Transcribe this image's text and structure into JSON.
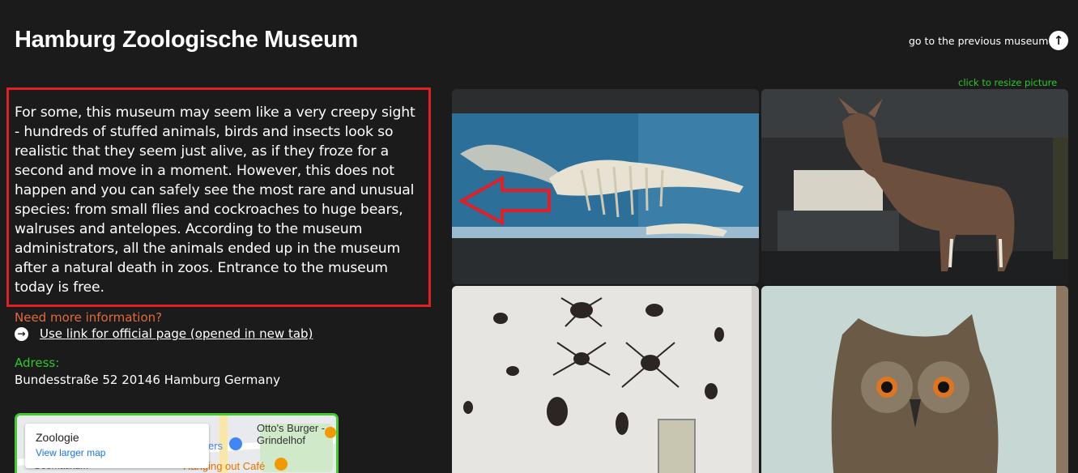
{
  "header": {
    "title": "Hamburg Zoologische Museum",
    "prev_museum_label": "go to the previous museum",
    "prev_icon": "arrow-up-circle-icon"
  },
  "gallery": {
    "resize_hint": "click to resize picture",
    "photos": [
      {
        "name": "whale-skeleton-photo",
        "subject": "whale skeleton exhibit"
      },
      {
        "name": "okapi-photo",
        "subject": "stuffed okapi"
      },
      {
        "name": "insects-photo",
        "subject": "spiders and insects collection"
      },
      {
        "name": "owl-photo",
        "subject": "stuffed eagle owl"
      }
    ]
  },
  "description": {
    "text": "For some, this museum may seem like a very creepy sight - hundreds of stuffed animals, birds and insects look so realistic that they seem just alive, as if they froze for a second and move in a moment. However, this does not happen and you can safely see the most rare and unusual species: from small flies and cockroaches to huge bears, walruses and antelopes. According to the museum administrators, all the animals ended up in the museum after a natural death in zoos. Entrance to the museum today is free."
  },
  "info": {
    "more_info_label": "Need more information?",
    "official_link_label": "Use link for official page (opened in new tab)",
    "arrow_icon": "arrow-right-circle-icon",
    "adress_label": "Adress:",
    "address": "Bundesstraße 52 20146 Hamburg Germany"
  },
  "map": {
    "place_name": "Zoologie",
    "view_larger_label": "View larger map",
    "poi_1": "Otto's Burger -",
    "poi_1b": "Grindelhof",
    "poi_2": "ers",
    "poi_3": "Hanging out Café",
    "poi_4": "Geomatikum"
  },
  "colors": {
    "background": "#1b1b1b",
    "highlight_border": "#e01f26",
    "accent_green": "#2ec82e",
    "accent_orange": "#e2693c"
  }
}
